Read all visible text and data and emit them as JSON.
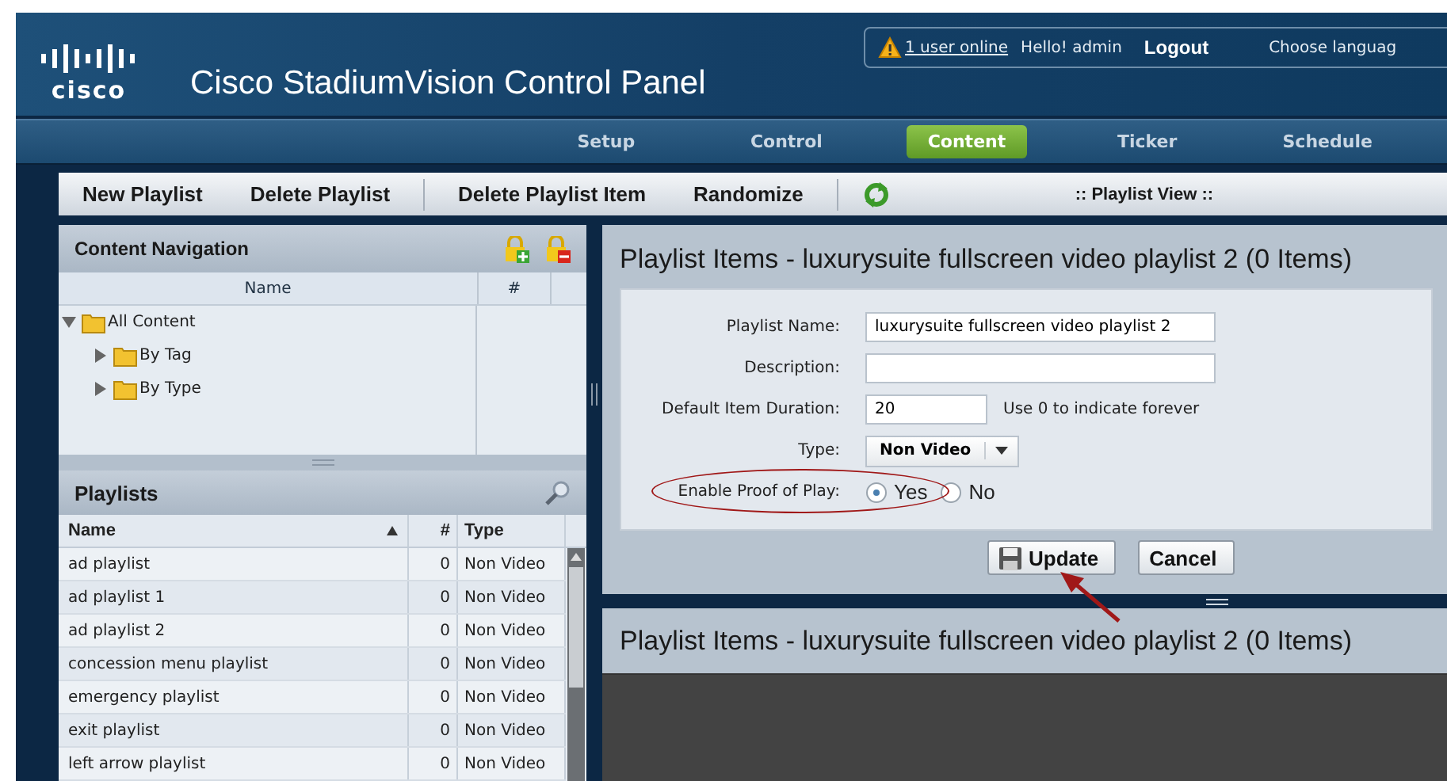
{
  "header": {
    "logo_text": "cisco",
    "title": "Cisco StadiumVision Control Panel",
    "users_online": "1 user online",
    "greeting": "Hello! admin",
    "logout": "Logout",
    "language": "Choose languag"
  },
  "nav_tabs": [
    {
      "label": "Setup",
      "selected": false
    },
    {
      "label": "Control",
      "selected": false
    },
    {
      "label": "Content",
      "selected": true
    },
    {
      "label": "Ticker",
      "selected": false
    },
    {
      "label": "Schedule",
      "selected": false
    }
  ],
  "toolbar": [
    {
      "kind": "button",
      "label": "New Playlist"
    },
    {
      "kind": "button",
      "label": "Delete Playlist"
    },
    {
      "kind": "separator"
    },
    {
      "kind": "button",
      "label": "Delete Playlist Item"
    },
    {
      "kind": "button",
      "label": "Randomize"
    },
    {
      "kind": "separator"
    },
    {
      "kind": "refresh"
    },
    {
      "kind": "title",
      "label": ":: Playlist View ::"
    }
  ],
  "content_navigation": {
    "title": "Content Navigation",
    "columns": [
      "Name",
      "#"
    ],
    "tree": [
      {
        "label": "All Content",
        "expanded": true,
        "children": [
          {
            "label": "By Tag",
            "expanded": false
          },
          {
            "label": "By Type",
            "expanded": false
          }
        ]
      }
    ]
  },
  "playlists": {
    "title": "Playlists",
    "columns": [
      {
        "label": "Name",
        "sorted": true
      },
      {
        "label": "#",
        "sorted": false
      },
      {
        "label": "Type",
        "sorted": false
      }
    ],
    "rows": [
      {
        "name": "ad playlist",
        "count": "0",
        "type": "Non Video"
      },
      {
        "name": "ad playlist 1",
        "count": "0",
        "type": "Non Video"
      },
      {
        "name": "ad playlist 2",
        "count": "0",
        "type": "Non Video"
      },
      {
        "name": "concession menu playlist",
        "count": "0",
        "type": "Non Video"
      },
      {
        "name": "emergency playlist",
        "count": "0",
        "type": "Non Video"
      },
      {
        "name": "exit playlist",
        "count": "0",
        "type": "Non Video"
      },
      {
        "name": "left arrow playlist",
        "count": "0",
        "type": "Non Video"
      }
    ]
  },
  "editor": {
    "title": "Playlist Items - luxurysuite fullscreen video playlist 2 (0 Items)",
    "fields": [
      {
        "kind": "text",
        "label": "Playlist Name:",
        "value": "luxurysuite fullscreen video playlist 2"
      },
      {
        "kind": "text",
        "label": "Description:"
      },
      {
        "kind": "short",
        "label": "Default Item Duration:",
        "value": "20",
        "hint": "Use 0 to indicate forever"
      },
      {
        "kind": "select",
        "label": "Type:",
        "value": "Non Video"
      },
      {
        "kind": "radio",
        "label": "Enable Proof of Play:",
        "highlighted": true,
        "options": [
          {
            "label": "Yes",
            "selected": true
          },
          {
            "label": "No",
            "selected": false
          }
        ]
      }
    ],
    "buttons": [
      {
        "kind": "save",
        "label": "Update",
        "pointed": true
      },
      {
        "kind": "plain",
        "label": "Cancel"
      }
    ]
  },
  "items_pane": {
    "title": "Playlist Items - luxurysuite fullscreen video playlist 2 (0 Items)"
  }
}
